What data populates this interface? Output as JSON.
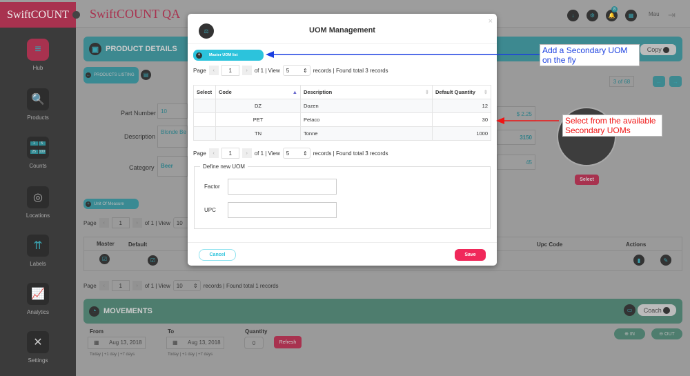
{
  "app": {
    "logo": "SwiftCOUNT",
    "title": "SwiftCOUNT QA",
    "user": "Mau",
    "notification_count": "8"
  },
  "sidebar": {
    "items": [
      {
        "label": "Hub",
        "icon": "hub-icon"
      },
      {
        "label": "Products",
        "icon": "barcode-search-icon"
      },
      {
        "label": "Counts",
        "icon": "counts-grid-icon"
      },
      {
        "label": "Locations",
        "icon": "location-target-icon"
      },
      {
        "label": "Labels",
        "icon": "labels-arrows-icon"
      },
      {
        "label": "Analytics",
        "icon": "analytics-icon"
      },
      {
        "label": "Settings",
        "icon": "tools-icon"
      }
    ],
    "counts_tiles": [
      "1",
      "5",
      "25",
      "100"
    ]
  },
  "product": {
    "header": "PRODUCT DETAILS",
    "copy": "Copy",
    "back_label": "PRODUCTS LISTING",
    "position": "3 of 68",
    "fields": {
      "part_number_label": "Part Number",
      "part_number": "10",
      "description_label": "Description",
      "description": "Blonde Be",
      "category_label": "Category",
      "category": "Beer"
    },
    "price": "$ 2.25",
    "val2": "3150",
    "val3": "45",
    "select": "Select"
  },
  "uom_section": {
    "label": "Unit Of Measure",
    "pager": {
      "page": "Page",
      "page_num": "1",
      "of": "of 1 | View",
      "view": "10",
      "found": "records | Found total 1 records"
    },
    "columns": [
      "Master",
      "Default",
      "Upc Code",
      "Actions"
    ]
  },
  "movements": {
    "header": "MOVEMENTS",
    "coach": "Coach",
    "in": "IN",
    "out": "OUT",
    "from_label": "From",
    "from": "Aug 13, 2018",
    "to_label": "To",
    "to": "Aug 13, 2018",
    "quantity_label": "Quantity",
    "quantity": "0",
    "refresh": "Refresh",
    "quick": [
      "Today",
      "|",
      "+1 day",
      "|",
      "+7 days"
    ]
  },
  "modal": {
    "title": "UOM Management",
    "close": "×",
    "master_btn": "Master UOM list",
    "pager": {
      "page": "Page",
      "page_num": "1",
      "of": "of 1 | View",
      "view": "5",
      "found": "records | Found total 3 records"
    },
    "columns": [
      "Select",
      "Code",
      "Description",
      "Default Quantity"
    ],
    "rows": [
      {
        "code": "DZ",
        "description": "Dozen",
        "qty": "12"
      },
      {
        "code": "PET",
        "description": "Petaco",
        "qty": "30"
      },
      {
        "code": "TN",
        "description": "Tonne",
        "qty": "1000"
      }
    ],
    "define_legend": "Define new UOM",
    "factor_label": "Factor",
    "factor": "",
    "upc_label": "UPC",
    "upc": "",
    "cancel": "Cancel",
    "save": "Save"
  },
  "annotations": {
    "blue": "Add a Secondary UOM on the fly",
    "red": "Select from the available Secondary UOMs",
    "blue_color": "#1a3fe0",
    "red_color": "#f01414"
  }
}
